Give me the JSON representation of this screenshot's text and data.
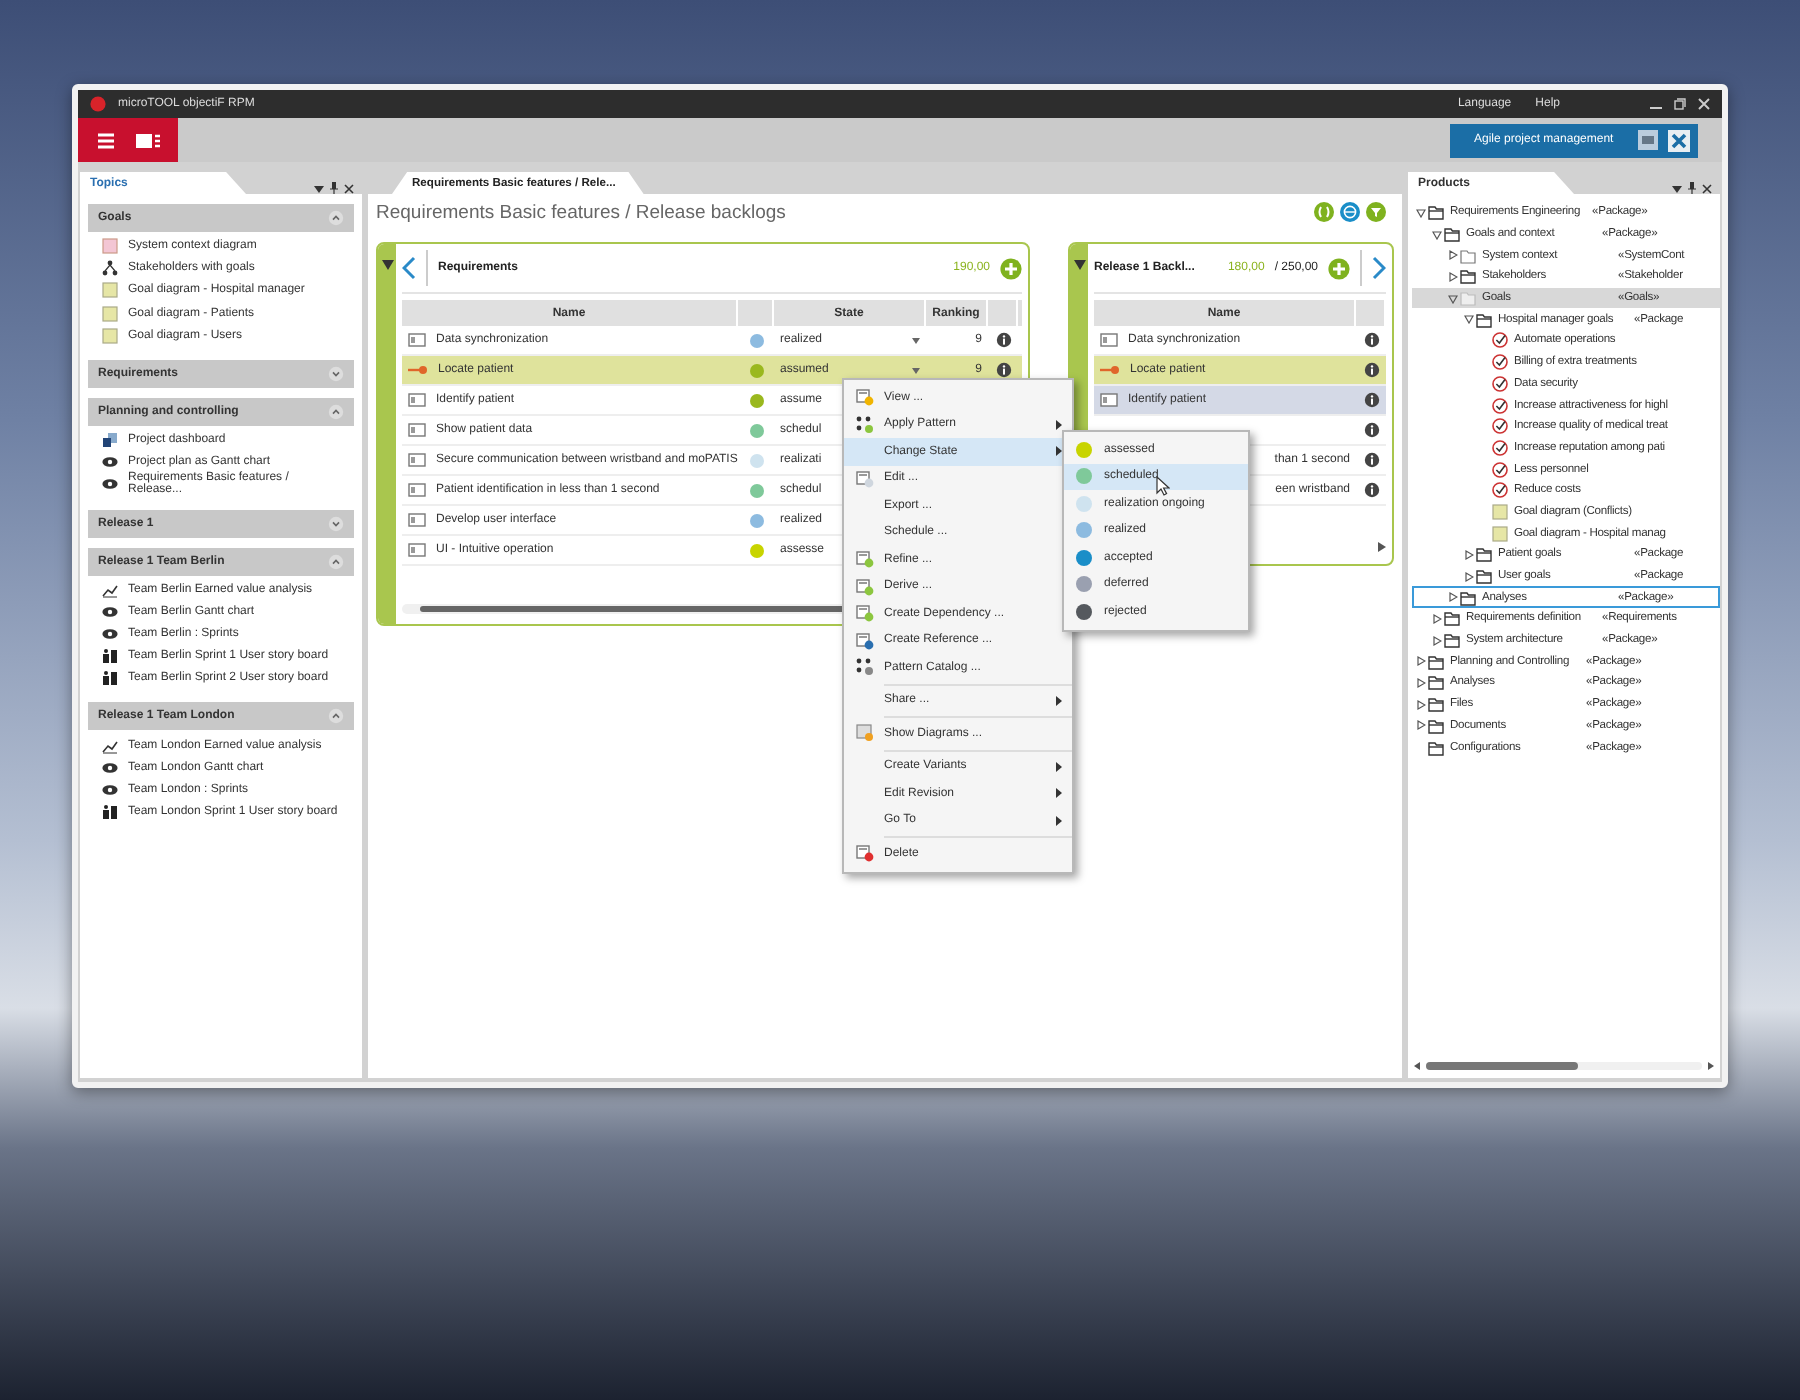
{
  "window": {
    "title": "microTOOL objectiF RPM",
    "menu": [
      "Language",
      "Help"
    ]
  },
  "toolbar": {
    "workspace": "Agile project management"
  },
  "topics": {
    "title": "Topics",
    "sections": [
      {
        "title": "Goals",
        "expanded": true,
        "items": [
          {
            "label": "System context diagram",
            "kind": "context-diagram"
          },
          {
            "label": "Stakeholders with goals",
            "kind": "hierarchy"
          },
          {
            "label": "Goal diagram - Hospital manager",
            "kind": "goal-diagram"
          },
          {
            "label": "Goal diagram - Patients",
            "kind": "goal-diagram"
          },
          {
            "label": "Goal diagram - Users",
            "kind": "goal-diagram"
          }
        ]
      },
      {
        "title": "Requirements",
        "expanded": false
      },
      {
        "title": "Planning and controlling",
        "expanded": true,
        "items": [
          {
            "label": "Project dashboard",
            "kind": "dashboard"
          },
          {
            "label": "Project plan as Gantt chart",
            "kind": "eye"
          },
          {
            "label": "Requirements Basic features / Release...",
            "kind": "eye"
          }
        ]
      },
      {
        "title": "Release 1",
        "expanded": false
      },
      {
        "title": "Release 1 Team Berlin",
        "expanded": true,
        "items": [
          {
            "label": "Team Berlin Earned value analysis",
            "kind": "chart"
          },
          {
            "label": "Team Berlin Gantt chart",
            "kind": "eye"
          },
          {
            "label": "Team Berlin : Sprints",
            "kind": "eye"
          },
          {
            "label": "Team Berlin Sprint 1 User story board",
            "kind": "board"
          },
          {
            "label": "Team Berlin Sprint 2 User story board",
            "kind": "board"
          }
        ]
      },
      {
        "title": "Release 1 Team London",
        "expanded": true,
        "items": [
          {
            "label": "Team London Earned value analysis",
            "kind": "chart"
          },
          {
            "label": "Team London Gantt chart",
            "kind": "eye"
          },
          {
            "label": "Team London : Sprints",
            "kind": "eye"
          },
          {
            "label": "Team London Sprint 1 User story board",
            "kind": "board"
          }
        ]
      }
    ]
  },
  "document": {
    "tab": "Requirements Basic features / Rele...",
    "heading": "Requirements Basic features / Release backlogs",
    "requirements": {
      "title": "Requirements",
      "total": "190,00",
      "columns": [
        "Name",
        "State",
        "Ranking"
      ],
      "rows": [
        {
          "name": "Data synchronization",
          "kind": "requirement",
          "color": "#8dbbe0",
          "state": "realized",
          "ranking": "9",
          "selected": false
        },
        {
          "name": "Locate patient",
          "kind": "feature",
          "color": "#9ab81e",
          "state": "assumed",
          "ranking": "9",
          "selected": true
        },
        {
          "name": "Identify patient",
          "kind": "requirement",
          "color": "#9ab81e",
          "state": "assume",
          "selected": false
        },
        {
          "name": "Show patient data",
          "kind": "requirement",
          "color": "#7fc99a",
          "state": "schedul",
          "selected": false
        },
        {
          "name": "Secure communication between wristband and moPATIS",
          "kind": "requirement",
          "color": "#cfe3ef",
          "state": "realizati",
          "selected": false
        },
        {
          "name": "Patient identification in less than 1 second",
          "kind": "requirement",
          "color": "#7fc99a",
          "state": "schedul",
          "selected": false
        },
        {
          "name": "Develop user interface",
          "kind": "requirement",
          "color": "#8dbbe0",
          "state": "realized",
          "selected": false
        },
        {
          "name": "UI - Intuitive operation",
          "kind": "requirement",
          "color": "#c8d400",
          "state": "assesse",
          "selected": false
        }
      ]
    },
    "backlog": {
      "title": "Release 1 Backl...",
      "planned": "180,00",
      "capacity": "/ 250,00",
      "columns": [
        "Name"
      ],
      "rows": [
        {
          "name": "Data synchronization",
          "kind": "requirement",
          "selected": false,
          "hovered": false,
          "cut_start": false
        },
        {
          "name": "Locate patient",
          "kind": "feature",
          "selected": true,
          "hovered": false,
          "cut_start": false
        },
        {
          "name": "Identify patient",
          "kind": "requirement",
          "selected": false,
          "hovered": true,
          "cut_start": false
        },
        {
          "selected": false,
          "hovered": false
        },
        {
          "name": "than 1 second",
          "selected": false,
          "hovered": false,
          "cut_start": true
        },
        {
          "name": "een wristband",
          "selected": false,
          "hovered": false,
          "cut_start": true
        }
      ]
    }
  },
  "context_menu": {
    "groups": [
      [
        {
          "label": "View ...",
          "kind": "view",
          "submenu": false,
          "selected": false
        },
        {
          "label": "Apply Pattern",
          "kind": "pattern",
          "submenu": true,
          "selected": false
        },
        {
          "label": "Change State",
          "kind": "plain",
          "submenu": true,
          "selected": true
        },
        {
          "label": "Edit ...",
          "kind": "edit",
          "submenu": false,
          "selected": false
        },
        {
          "label": "Export ...",
          "kind": "plain",
          "submenu": false,
          "selected": false
        },
        {
          "label": "Schedule ...",
          "kind": "plain",
          "submenu": false,
          "selected": false
        },
        {
          "label": "Refine ...",
          "kind": "add",
          "submenu": false,
          "selected": false
        },
        {
          "label": "Derive ...",
          "kind": "add",
          "submenu": false,
          "selected": false
        },
        {
          "label": "Create Dependency ...",
          "kind": "add",
          "submenu": false,
          "selected": false
        },
        {
          "label": "Create Reference ...",
          "kind": "reference",
          "submenu": false,
          "selected": false
        },
        {
          "label": "Pattern Catalog ...",
          "kind": "catalog",
          "submenu": false,
          "selected": false
        }
      ],
      [
        {
          "label": "Share ...",
          "kind": "plain",
          "submenu": true,
          "selected": false
        }
      ],
      [
        {
          "label": "Show Diagrams ...",
          "kind": "diagrams",
          "submenu": false,
          "selected": false
        }
      ],
      [
        {
          "label": "Create Variants",
          "kind": "plain",
          "submenu": true,
          "selected": false
        },
        {
          "label": "Edit Revision",
          "kind": "plain",
          "submenu": true,
          "selected": false
        },
        {
          "label": "Go To",
          "kind": "plain",
          "submenu": true,
          "selected": false
        }
      ],
      [
        {
          "label": "Delete",
          "kind": "delete",
          "submenu": false,
          "selected": false
        }
      ]
    ]
  },
  "state_menu": {
    "items": [
      {
        "label": "assessed",
        "color": "#c8d400",
        "selected": false
      },
      {
        "label": "scheduled",
        "color": "#7fc99a",
        "selected": true
      },
      {
        "label": "realization ongoing",
        "color": "#cfe3ef",
        "selected": false
      },
      {
        "label": "realized",
        "color": "#8dbbe0",
        "selected": false
      },
      {
        "label": "accepted",
        "color": "#1a8ec8",
        "selected": false
      },
      {
        "label": "deferred",
        "color": "#9aa0b0",
        "selected": false
      },
      {
        "label": "rejected",
        "color": "#55595e",
        "selected": false
      }
    ]
  },
  "products": {
    "title": "Products",
    "tree": [
      {
        "name": "Requirements Engineering",
        "stereotype": "«Package»",
        "kind": "package",
        "expanded": true,
        "selected": false,
        "focused": false,
        "children": [
          {
            "name": "Goals and context",
            "stereotype": "«Package»",
            "kind": "package",
            "expanded": true,
            "selected": false,
            "focused": false,
            "children": [
              {
                "name": "System context",
                "stereotype": "«SystemCont",
                "kind": "folder",
                "expanded": false,
                "selected": false,
                "focused": false
              },
              {
                "name": "Stakeholders",
                "stereotype": "«Stakeholder",
                "kind": "package",
                "expanded": false,
                "selected": false,
                "focused": false
              },
              {
                "name": "Goals",
                "stereotype": "«Goals»",
                "kind": "goals",
                "expanded": true,
                "selected": true,
                "focused": false,
                "children": [
                  {
                    "name": "Hospital manager goals",
                    "stereotype": "«Package",
                    "kind": "package",
                    "expanded": true,
                    "selected": false,
                    "focused": false,
                    "children": [
                      {
                        "name": "Automate operations",
                        "kind": "goal",
                        "selected": false,
                        "focused": false
                      },
                      {
                        "name": "Billing of extra treatments",
                        "kind": "goal",
                        "selected": false,
                        "focused": false
                      },
                      {
                        "name": "Data security",
                        "kind": "goal",
                        "selected": false,
                        "focused": false
                      },
                      {
                        "name": "Increase attractiveness for highl",
                        "kind": "goal",
                        "selected": false,
                        "focused": false
                      },
                      {
                        "name": "Increase quality of medical treat",
                        "kind": "goal",
                        "selected": false,
                        "focused": false
                      },
                      {
                        "name": "Increase reputation among pati",
                        "kind": "goal",
                        "selected": false,
                        "focused": false
                      },
                      {
                        "name": "Less personnel",
                        "kind": "goal",
                        "selected": false,
                        "focused": false
                      },
                      {
                        "name": "Reduce costs",
                        "kind": "goal",
                        "selected": false,
                        "focused": false
                      },
                      {
                        "name": "Goal diagram (Conflicts)",
                        "kind": "diagram",
                        "selected": false,
                        "focused": false
                      },
                      {
                        "name": "Goal diagram - Hospital manag",
                        "kind": "diagram",
                        "selected": false,
                        "focused": false
                      }
                    ]
                  },
                  {
                    "name": "Patient goals",
                    "stereotype": "«Package",
                    "kind": "package",
                    "expanded": false,
                    "selected": false,
                    "focused": false
                  },
                  {
                    "name": "User goals",
                    "stereotype": "«Package",
                    "kind": "package",
                    "expanded": false,
                    "selected": false,
                    "focused": false
                  }
                ]
              },
              {
                "name": "Analyses",
                "stereotype": "«Package»",
                "kind": "package",
                "expanded": false,
                "selected": false,
                "focused": true
              }
            ]
          },
          {
            "name": "Requirements definition",
            "stereotype": "«Requirements",
            "kind": "package",
            "expanded": false,
            "selected": false,
            "focused": false
          },
          {
            "name": "System architecture",
            "stereotype": "«Package»",
            "kind": "package",
            "expanded": false,
            "selected": false,
            "focused": false
          }
        ]
      },
      {
        "name": "Planning and Controlling",
        "stereotype": "«Package»",
        "kind": "package",
        "expanded": false,
        "selected": false,
        "focused": false
      },
      {
        "name": "Analyses",
        "stereotype": "«Package»",
        "kind": "package",
        "expanded": false,
        "selected": false,
        "focused": false
      },
      {
        "name": "Files",
        "stereotype": "«Package»",
        "kind": "package",
        "expanded": false,
        "selected": false,
        "focused": false
      },
      {
        "name": "Documents",
        "stereotype": "«Package»",
        "kind": "package",
        "expanded": false,
        "selected": false,
        "focused": false
      },
      {
        "name": "Configurations",
        "stereotype": "«Package»",
        "kind": "package",
        "selected": false,
        "focused": false
      }
    ]
  }
}
